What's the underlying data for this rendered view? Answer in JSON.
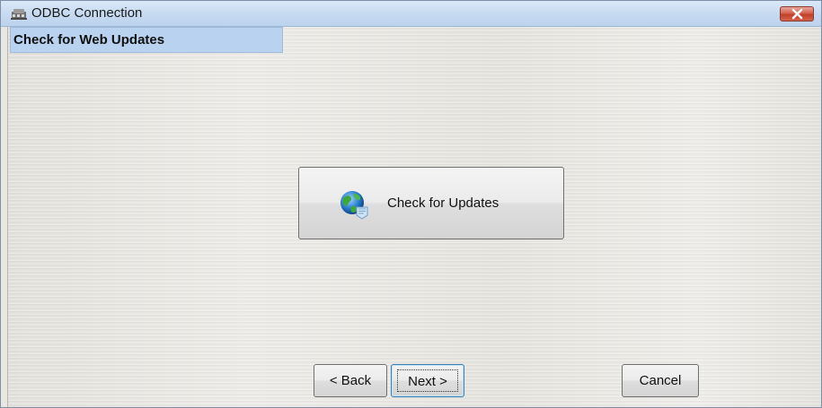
{
  "window": {
    "title": "ODBC Connection"
  },
  "section": {
    "header": "Check for Web Updates"
  },
  "main": {
    "check_updates_label": "Check for Updates"
  },
  "footer": {
    "back_label": "< Back",
    "next_label": "Next >",
    "cancel_label": "Cancel"
  },
  "icons": {
    "app": "odbc-app-icon",
    "close": "close-icon",
    "globe": "globe-update-icon"
  },
  "colors": {
    "header_bg": "#b8d2ef",
    "close_button": "#c2402a",
    "focus_border": "#3c7fb1"
  }
}
